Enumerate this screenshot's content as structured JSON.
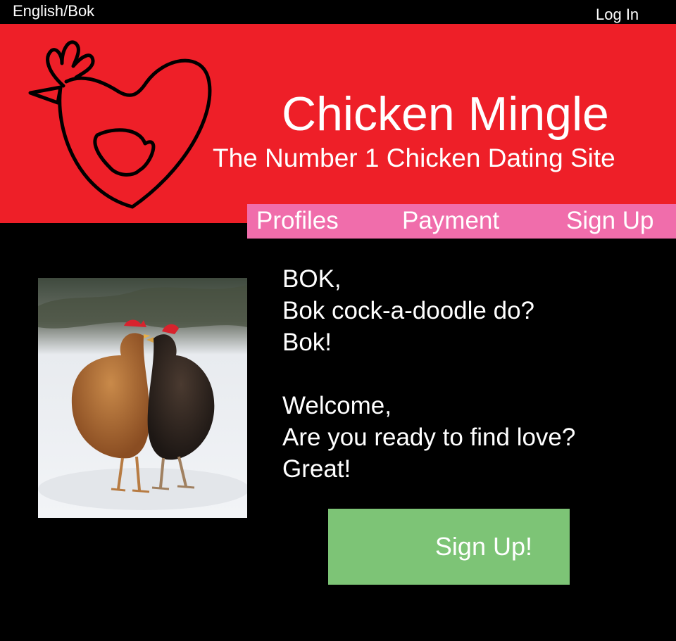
{
  "topbar": {
    "language_label": "English/Bok",
    "login_label": "Log In"
  },
  "banner": {
    "title": "Chicken Mingle",
    "subtitle": "The Number 1 Chicken Dating Site",
    "background_color": "#ee1f28",
    "logo_icon": "heart-chicken-icon"
  },
  "nav": {
    "background_color": "#f06dab",
    "items": [
      {
        "label": "Profiles"
      },
      {
        "label": "Payment"
      },
      {
        "label": "Sign Up"
      }
    ]
  },
  "main": {
    "photo_description_icon": "two-chickens-photo",
    "greeting_lines": [
      "BOK,",
      "Bok cock-a-doodle do?",
      "Bok!"
    ],
    "welcome_lines": [
      "Welcome,",
      "Are you ready to find love?",
      "Great!"
    ],
    "cta_label": "Sign Up!",
    "cta_color": "#7dc476"
  }
}
